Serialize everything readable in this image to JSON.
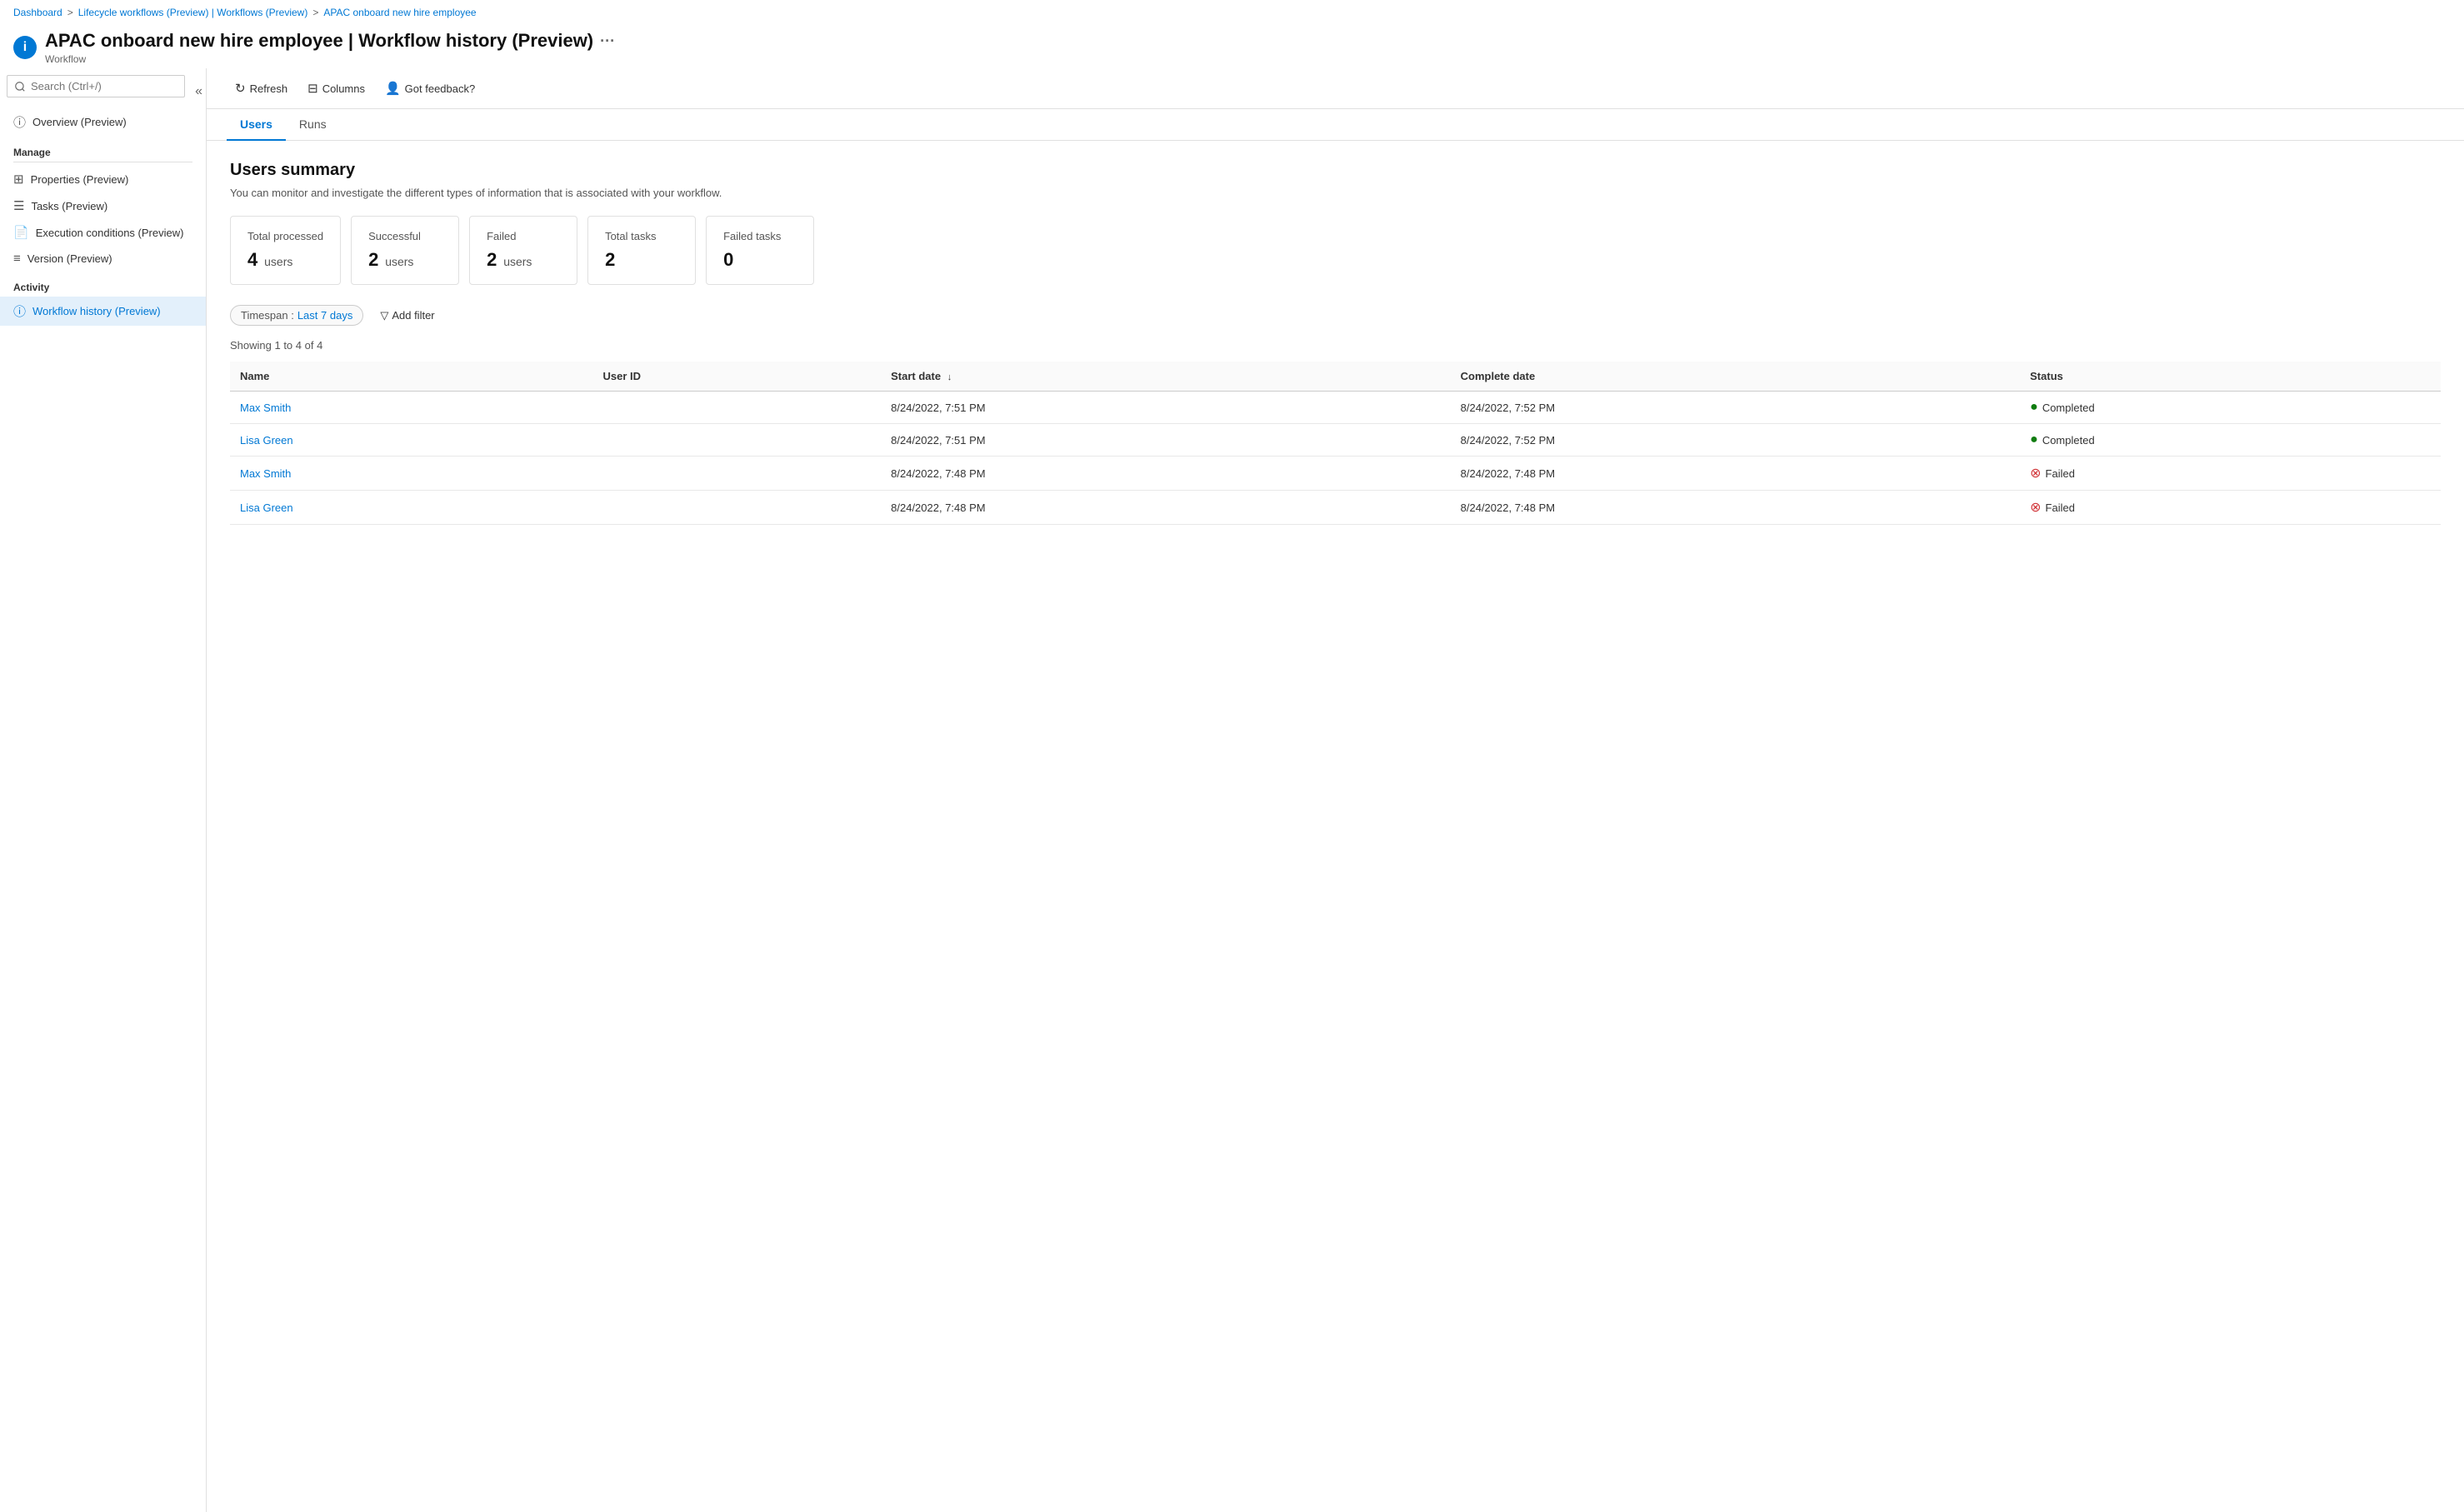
{
  "breadcrumb": {
    "items": [
      {
        "label": "Dashboard",
        "link": true
      },
      {
        "label": "Lifecycle workflows (Preview) | Workflows (Preview)",
        "link": true
      },
      {
        "label": "APAC onboard new hire employee",
        "link": true
      }
    ]
  },
  "page": {
    "icon": "i",
    "title": "APAC onboard new hire employee | Workflow history (Preview)",
    "subtitle": "Workflow",
    "ellipsis": "···"
  },
  "sidebar": {
    "search_placeholder": "Search (Ctrl+/)",
    "overview_label": "Overview (Preview)",
    "manage_label": "Manage",
    "manage_items": [
      {
        "id": "properties",
        "label": "Properties (Preview)",
        "icon": "⊞"
      },
      {
        "id": "tasks",
        "label": "Tasks (Preview)",
        "icon": "☰"
      },
      {
        "id": "execution",
        "label": "Execution conditions (Preview)",
        "icon": "📄"
      },
      {
        "id": "version",
        "label": "Version (Preview)",
        "icon": "≡"
      }
    ],
    "activity_label": "Activity",
    "activity_items": [
      {
        "id": "workflow-history",
        "label": "Workflow history (Preview)",
        "icon": "ⓘ",
        "active": true
      }
    ]
  },
  "toolbar": {
    "refresh_label": "Refresh",
    "columns_label": "Columns",
    "feedback_label": "Got feedback?"
  },
  "tabs": [
    {
      "id": "users",
      "label": "Users",
      "active": true
    },
    {
      "id": "runs",
      "label": "Runs",
      "active": false
    }
  ],
  "section": {
    "title": "Users summary",
    "description": "You can monitor and investigate the different types of information that is associated with your workflow."
  },
  "summary_cards": [
    {
      "id": "total-processed",
      "label": "Total processed",
      "value": "4",
      "unit": "users"
    },
    {
      "id": "successful",
      "label": "Successful",
      "value": "2",
      "unit": "users"
    },
    {
      "id": "failed",
      "label": "Failed",
      "value": "2",
      "unit": "users"
    },
    {
      "id": "total-tasks",
      "label": "Total tasks",
      "value": "2",
      "unit": ""
    },
    {
      "id": "failed-tasks",
      "label": "Failed tasks",
      "value": "0",
      "unit": ""
    }
  ],
  "filter": {
    "timespan_label": "Timespan",
    "timespan_value": "Last 7 days",
    "add_filter_label": "Add filter"
  },
  "showing_text": "Showing 1 to 4 of 4",
  "table": {
    "columns": [
      {
        "id": "name",
        "label": "Name",
        "sortable": false
      },
      {
        "id": "user-id",
        "label": "User ID",
        "sortable": false
      },
      {
        "id": "start-date",
        "label": "Start date",
        "sortable": true
      },
      {
        "id": "complete-date",
        "label": "Complete date",
        "sortable": false
      },
      {
        "id": "status",
        "label": "Status",
        "sortable": false
      }
    ],
    "rows": [
      {
        "id": 1,
        "name": "Max Smith",
        "user_id": "",
        "start_date": "8/24/2022, 7:51 PM",
        "complete_date": "8/24/2022, 7:52 PM",
        "status": "Completed",
        "status_type": "completed"
      },
      {
        "id": 2,
        "name": "Lisa Green",
        "user_id": "",
        "start_date": "8/24/2022, 7:51 PM",
        "complete_date": "8/24/2022, 7:52 PM",
        "status": "Completed",
        "status_type": "completed"
      },
      {
        "id": 3,
        "name": "Max Smith",
        "user_id": "",
        "start_date": "8/24/2022, 7:48 PM",
        "complete_date": "8/24/2022, 7:48 PM",
        "status": "Failed",
        "status_type": "failed"
      },
      {
        "id": 4,
        "name": "Lisa Green",
        "user_id": "",
        "start_date": "8/24/2022, 7:48 PM",
        "complete_date": "8/24/2022, 7:48 PM",
        "status": "Failed",
        "status_type": "failed"
      }
    ]
  },
  "colors": {
    "accent": "#0078d4",
    "success": "#107c10",
    "error": "#d13438",
    "border": "#e0e0e0",
    "bg_active": "#e3f0fb"
  }
}
